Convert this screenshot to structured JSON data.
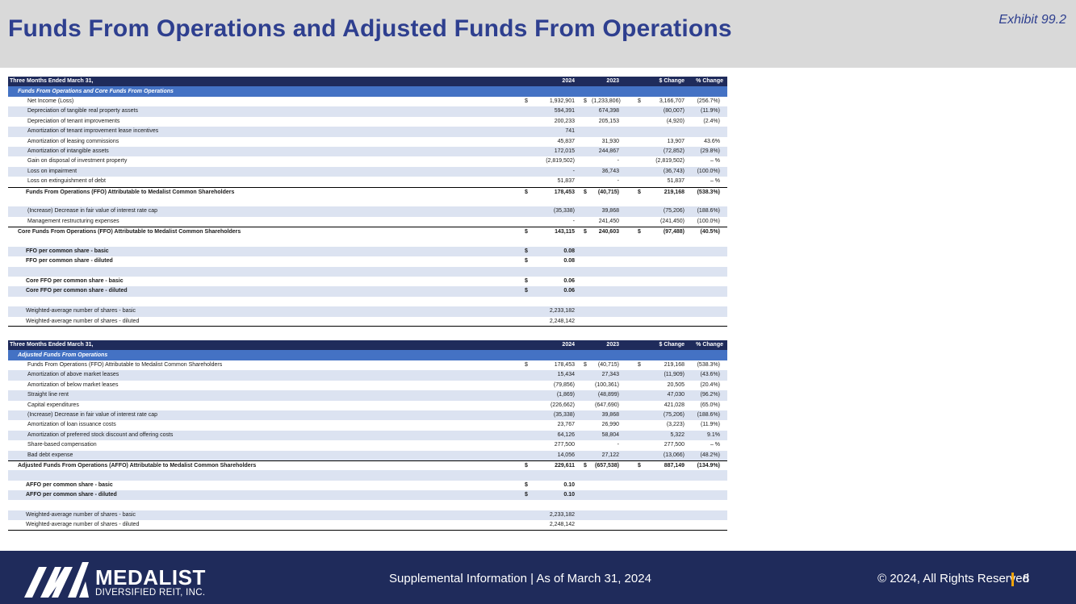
{
  "header": {
    "title": "Funds From Operations and Adjusted Funds From Operations",
    "exhibit": "Exhibit 99.2"
  },
  "table1": {
    "columns": [
      "Three Months Ended March 31,",
      "2024",
      "2023",
      "$ Change",
      "% Change"
    ],
    "section": "Funds From Operations and Core Funds From Operations",
    "rows": [
      {
        "label": "Net Income (Loss)",
        "d1": "$",
        "v2024": "1,932,901",
        "d2": "$",
        "v2023": "(1,233,806)",
        "d3": "$",
        "change": "3,166,707",
        "pct": "(256.7%)"
      },
      {
        "label": "Depreciation of tangible real property assets",
        "v2024": "594,391",
        "v2023": "674,398",
        "change": "(80,007)",
        "pct": "(11.9%)"
      },
      {
        "label": "Depreciation of tenant improvements",
        "v2024": "200,233",
        "v2023": "205,153",
        "change": "(4,920)",
        "pct": "(2.4%)"
      },
      {
        "label": "Amortization of tenant improvement lease incentives",
        "v2024": "741",
        "v2023": "",
        "change": "",
        "pct": ""
      },
      {
        "label": "Amortization of leasing commissions",
        "v2024": "45,837",
        "v2023": "31,930",
        "change": "13,907",
        "pct": "43.6%"
      },
      {
        "label": "Amortization of intangible assets",
        "v2024": "172,015",
        "v2023": "244,867",
        "change": "(72,852)",
        "pct": "(29.8%)"
      },
      {
        "label": "Gain on disposal of investment property",
        "v2024": "(2,819,502)",
        "v2023": "-",
        "change": "(2,819,502)",
        "pct": "– %"
      },
      {
        "label": "Loss on impairment",
        "v2024": "-",
        "v2023": "36,743",
        "change": "(36,743)",
        "pct": "(100.0%)"
      },
      {
        "label": "Loss on extinguishment of debt",
        "v2024": "51,837",
        "v2023": "-",
        "change": "51,837",
        "pct": "– %"
      }
    ],
    "ffo": {
      "label": "Funds From Operations (FFO) Attributable to Medalist Common Shareholders",
      "d1": "$",
      "v2024": "178,453",
      "d2": "$",
      "v2023": "(40,715)",
      "d3": "$",
      "change": "219,168",
      "pct": "(538.3%)"
    },
    "adjustments": [
      {
        "label": "(Increase) Decrease in fair value of interest rate cap",
        "v2024": "(35,338)",
        "v2023": "39,868",
        "change": "(75,206)",
        "pct": "(188.6%)"
      },
      {
        "label": "Management restructuring expenses",
        "v2024": "-",
        "v2023": "241,450",
        "change": "(241,450)",
        "pct": "(100.0%)"
      }
    ],
    "core_ffo": {
      "label": "Core Funds From Operations (FFO) Attributable to Medalist Common Shareholders",
      "d1": "$",
      "v2024": "143,115",
      "d2": "$",
      "v2023": "240,603",
      "d3": "$",
      "change": "(97,488)",
      "pct": "(40.5%)"
    },
    "per_share": [
      {
        "label": "FFO per common share - basic",
        "d1": "$",
        "v2024": "0.08"
      },
      {
        "label": "FFO per common share - diluted",
        "d1": "$",
        "v2024": "0.08"
      },
      {
        "label": "Core FFO per common share - basic",
        "d1": "$",
        "v2024": "0.06"
      },
      {
        "label": "Core FFO per common share - diluted",
        "d1": "$",
        "v2024": "0.06"
      }
    ],
    "shares": [
      {
        "label": "Weighted-average number of shares - basic",
        "v2024": "2,233,182"
      },
      {
        "label": "Weighted-average number of shares - diluted",
        "v2024": "2,248,142"
      }
    ]
  },
  "table2": {
    "columns": [
      "Three Months Ended March 31,",
      "2024",
      "2023",
      "$ Change",
      "% Change"
    ],
    "section": "Adjusted Funds From Operations",
    "rows": [
      {
        "label": "Funds From Operations (FFO) Attributable to Medalist Common Shareholders",
        "d1": "$",
        "v2024": "178,453",
        "d2": "$",
        "v2023": "(40,715)",
        "d3": "$",
        "change": "219,168",
        "pct": "(538.3%)"
      },
      {
        "label": "Amortization of above market leases",
        "v2024": "15,434",
        "v2023": "27,343",
        "change": "(11,909)",
        "pct": "(43.6%)"
      },
      {
        "label": "Amortization of below market leases",
        "v2024": "(79,856)",
        "v2023": "(100,361)",
        "change": "20,505",
        "pct": "(20.4%)"
      },
      {
        "label": "Straight line rent",
        "v2024": "(1,869)",
        "v2023": "(48,899)",
        "change": "47,030",
        "pct": "(96.2%)"
      },
      {
        "label": "Capital expenditures",
        "v2024": "(226,662)",
        "v2023": "(647,690)",
        "change": "421,028",
        "pct": "(65.0%)"
      },
      {
        "label": "(Increase) Decrease in fair value of interest rate cap",
        "v2024": "(35,338)",
        "v2023": "39,868",
        "change": "(75,206)",
        "pct": "(188.6%)"
      },
      {
        "label": "Amortization of loan issuance costs",
        "v2024": "23,767",
        "v2023": "26,990",
        "change": "(3,223)",
        "pct": "(11.9%)"
      },
      {
        "label": "Amortization of preferred stock discount and offering costs",
        "v2024": "64,126",
        "v2023": "58,804",
        "change": "5,322",
        "pct": "9.1%"
      },
      {
        "label": "Share-based compensation",
        "v2024": "277,500",
        "v2023": "-",
        "change": "277,500",
        "pct": "– %"
      },
      {
        "label": "Bad debt expense",
        "v2024": "14,056",
        "v2023": "27,122",
        "change": "(13,066)",
        "pct": "(48.2%)"
      }
    ],
    "affo": {
      "label": "Adjusted Funds From Operations (AFFO) Attributable to Medalist Common Shareholders",
      "d1": "$",
      "v2024": "229,611",
      "d2": "$",
      "v2023": "(657,538)",
      "d3": "$",
      "change": "887,149",
      "pct": "(134.9%)"
    },
    "per_share": [
      {
        "label": "AFFO per common share - basic",
        "d1": "$",
        "v2024": "0.10"
      },
      {
        "label": "AFFO per common share - diluted",
        "d1": "$",
        "v2024": "0.10"
      }
    ],
    "shares": [
      {
        "label": "Weighted-average number of shares - basic",
        "v2024": "2,233,182"
      },
      {
        "label": "Weighted-average number of shares - diluted",
        "v2024": "2,248,142"
      }
    ]
  },
  "footer": {
    "logo_name": "MEDALIST",
    "logo_sub": "DIVERSIFIED REIT, INC.",
    "center": "Supplemental Information | As of March 31, 2024",
    "copyright": "© 2024, All Rights Reserved",
    "page": "8"
  },
  "colors": {
    "title": "#2e3f8f",
    "header_bg": "#d9d9d9",
    "table_head": "#1f2b5b",
    "section_bar": "#4472c4",
    "row_band": "#dce3f1",
    "footer_bg": "#1f2b5b",
    "footer_accent": "#f0a30a"
  }
}
